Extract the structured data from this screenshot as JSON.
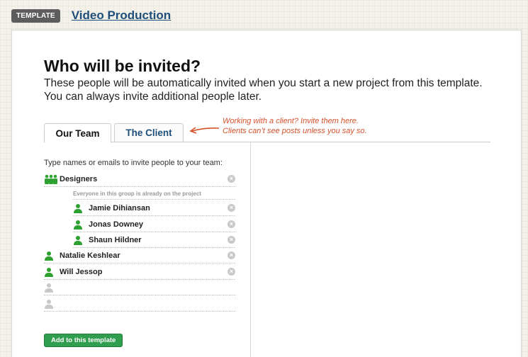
{
  "header": {
    "badge": "TEMPLATE",
    "project_title": "Video Production"
  },
  "main": {
    "heading": "Who will be invited?",
    "intro": "These people will be automatically invited when you start a new project from this template. You can always invite additional people later."
  },
  "tabs": [
    {
      "label": "Our Team",
      "active": true
    },
    {
      "label": "The Client",
      "active": false
    }
  ],
  "callout": {
    "line1": "Working with a client? Invite them here.",
    "line2": "Clients can’t see posts unless you say so."
  },
  "invite": {
    "instructions": "Type names or emails to invite people to your team:",
    "group": {
      "name": "Designers",
      "note": "Everyone in this group is already on the project",
      "members": [
        "Jamie Dihiansan",
        "Jonas Downey",
        "Shaun Hildner"
      ]
    },
    "people": [
      "Natalie Keshlear",
      "Will Jessop"
    ],
    "add_button": "Add to this template"
  },
  "colors": {
    "accent_green": "#2f9e4e",
    "link_blue": "#1e4e79",
    "callout_orange": "#d4512a",
    "person_icon_active": "#2ca12f",
    "person_icon_empty": "#c8c8c8"
  },
  "icons": {
    "group": "group-icon",
    "person": "person-icon",
    "remove": "remove-icon",
    "arrow": "arrow-left-icon"
  }
}
